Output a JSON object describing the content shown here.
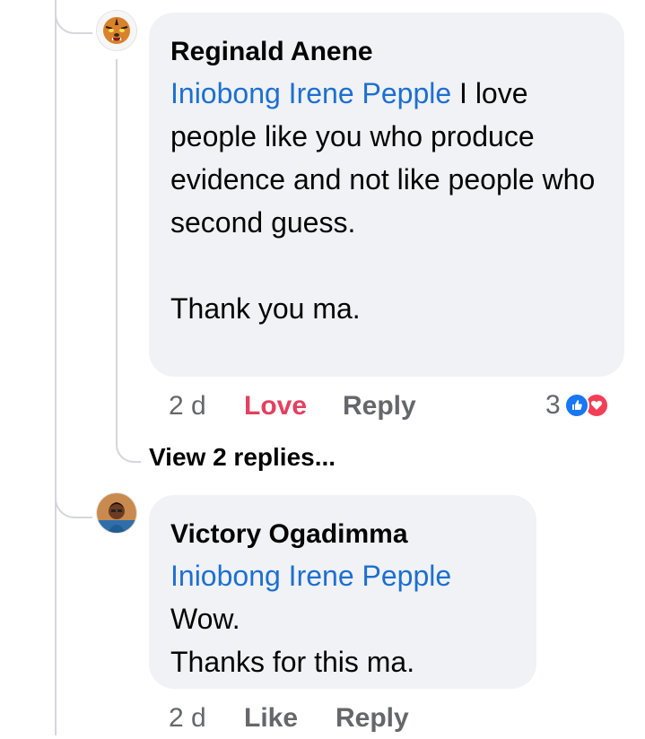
{
  "comments": [
    {
      "author": "Reginald Anene",
      "mention": "Iniobong Irene Pepple",
      "text": " I love people like you who produce evidence and not like people who second guess.\n\nThank you ma.",
      "time": "2 d",
      "reaction_action": "Love",
      "reply": "Reply",
      "reaction_count": "3",
      "reaction_types": [
        "like",
        "love"
      ]
    },
    {
      "author": "Victory Ogadimma",
      "mention": "Iniobong Irene Pepple",
      "text": "Wow.\nThanks for this ma.",
      "time": "2 d",
      "reaction_action": "Like",
      "reply": "Reply"
    }
  ],
  "view_replies": "View 2 replies...",
  "colors": {
    "mention": "#1d6fd1",
    "love": "#e4405f",
    "like_icon": "#1877f2",
    "bubble": "#f0f2f5"
  }
}
